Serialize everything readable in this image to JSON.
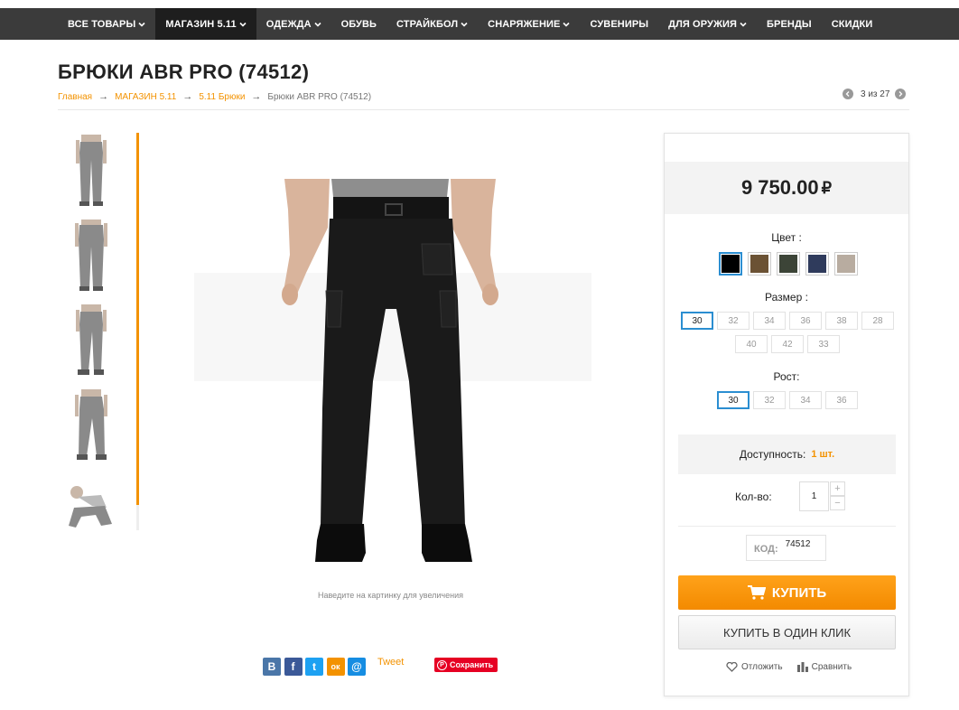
{
  "nav": {
    "items": [
      {
        "label": "ВСЕ ТОВАРЫ",
        "dropdown": true,
        "active": false
      },
      {
        "label": "МАГАЗИН 5.11",
        "dropdown": true,
        "active": true
      },
      {
        "label": "ОДЕЖДА",
        "dropdown": true,
        "active": false
      },
      {
        "label": "ОБУВЬ",
        "dropdown": false,
        "active": false
      },
      {
        "label": "СТРАЙКБОЛ",
        "dropdown": true,
        "active": false
      },
      {
        "label": "СНАРЯЖЕНИЕ",
        "dropdown": true,
        "active": false
      },
      {
        "label": "СУВЕНИРЫ",
        "dropdown": false,
        "active": false
      },
      {
        "label": "ДЛЯ ОРУЖИЯ",
        "dropdown": true,
        "active": false
      },
      {
        "label": "БРЕНДЫ",
        "dropdown": false,
        "active": false
      },
      {
        "label": "СКИДКИ",
        "dropdown": false,
        "active": false
      }
    ]
  },
  "page": {
    "title": "БРЮКИ ABR PRO (74512)"
  },
  "breadcrumb": {
    "items": [
      "Главная",
      "МАГАЗИН 5.11",
      "5.11 Брюки"
    ],
    "current": "Брюки ABR PRO (74512)",
    "separator": "→"
  },
  "pager": {
    "text": "3 из 27"
  },
  "gallery": {
    "zoom_hint": "Наведите на картинку для увеличения"
  },
  "share": {
    "tweet": "Tweet",
    "pinterest": "Сохранить",
    "buttons": [
      {
        "icon": "vk-icon",
        "glyph": "В",
        "color": "#4a76a8"
      },
      {
        "icon": "facebook-icon",
        "glyph": "f",
        "color": "#3b5998"
      },
      {
        "icon": "twitter-icon",
        "glyph": "t",
        "color": "#1da1f2"
      },
      {
        "icon": "odnoklassniki-icon",
        "glyph": "ок",
        "color": "#f39200"
      },
      {
        "icon": "mailru-icon",
        "glyph": "@",
        "color": "#168de2"
      }
    ]
  },
  "buy": {
    "price": "9 750.00",
    "currency": "₽",
    "color_label": "Цвет :",
    "colors": [
      {
        "name": "black",
        "hex": "#000000",
        "selected": true
      },
      {
        "name": "brown",
        "hex": "#6b5234",
        "selected": false
      },
      {
        "name": "ranger-green",
        "hex": "#3c4437",
        "selected": false
      },
      {
        "name": "navy",
        "hex": "#2f3b5c",
        "selected": false
      },
      {
        "name": "khaki",
        "hex": "#b8aca0",
        "selected": false
      }
    ],
    "size_label": "Размер :",
    "sizes": [
      {
        "v": "30",
        "selected": true
      },
      {
        "v": "32",
        "selected": false
      },
      {
        "v": "34",
        "selected": false
      },
      {
        "v": "36",
        "selected": false
      },
      {
        "v": "38",
        "selected": false
      },
      {
        "v": "28",
        "selected": false
      },
      {
        "v": "40",
        "selected": false
      },
      {
        "v": "42",
        "selected": false
      },
      {
        "v": "33",
        "selected": false
      }
    ],
    "height_label": "Рост:",
    "heights": [
      {
        "v": "30",
        "selected": true
      },
      {
        "v": "32",
        "selected": false
      },
      {
        "v": "34",
        "selected": false
      },
      {
        "v": "36",
        "selected": false
      }
    ],
    "availability_label": "Доступность:",
    "availability_value": "1 шт.",
    "qty_label": "Кол-во:",
    "qty_value": "1",
    "qty_plus": "+",
    "qty_minus": "−",
    "code_label": "КОД:",
    "code_value": "74512",
    "buy_label": "КУПИТЬ",
    "one_click_label": "КУПИТЬ В ОДИН КЛИК",
    "wishlist_label": "Отложить",
    "compare_label": "Сравнить"
  },
  "colors": {
    "accent": "#f39200",
    "nav_bg": "#3b3b3b",
    "selected_border": "#2b8ed1"
  }
}
